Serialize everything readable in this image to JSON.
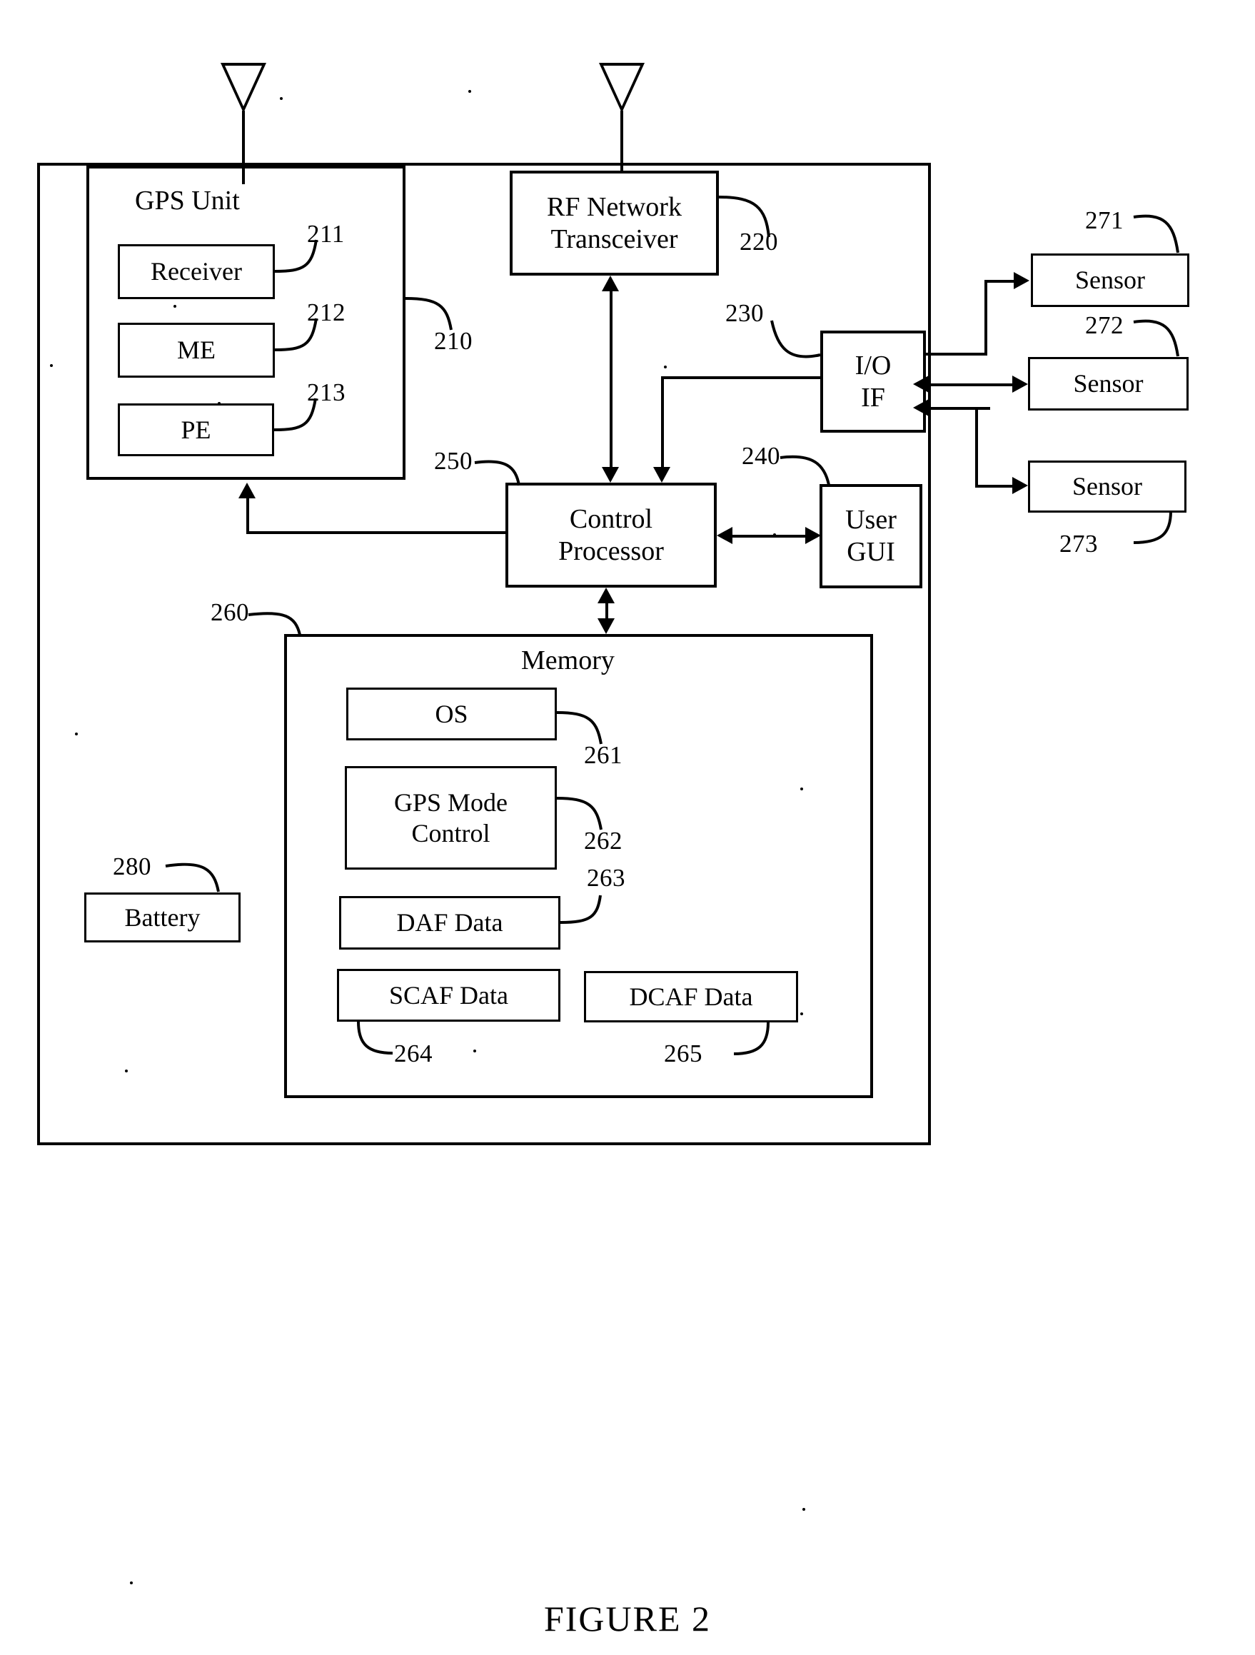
{
  "figure": {
    "caption": "FIGURE 2",
    "type": "patent-block-diagram"
  },
  "blocks": {
    "device_outer": {
      "label": "",
      "ref": ""
    },
    "gps_unit": {
      "label": "GPS Unit",
      "ref": "210"
    },
    "receiver": {
      "label": "Receiver",
      "ref": "211"
    },
    "me": {
      "label": "ME",
      "ref": "212"
    },
    "pe": {
      "label": "PE",
      "ref": "213"
    },
    "rf_transceiver": {
      "label": "RF Network\nTransceiver",
      "ref": "220"
    },
    "io_if": {
      "label": "I/O\nIF",
      "ref": "230"
    },
    "user_gui": {
      "label": "User\nGUI",
      "ref": "240"
    },
    "control_processor": {
      "label": "Control\nProcessor",
      "ref": "250"
    },
    "memory": {
      "label": "Memory",
      "ref": "260"
    },
    "os": {
      "label": "OS",
      "ref": "261"
    },
    "gps_mode_control": {
      "label": "GPS Mode\nControl",
      "ref": "262"
    },
    "daf_data": {
      "label": "DAF Data",
      "ref": "263"
    },
    "scaf_data": {
      "label": "SCAF Data",
      "ref": "264"
    },
    "dcaf_data": {
      "label": "DCAF Data",
      "ref": "265"
    },
    "sensor_1": {
      "label": "Sensor",
      "ref": "271"
    },
    "sensor_2": {
      "label": "Sensor",
      "ref": "272"
    },
    "sensor_3": {
      "label": "Sensor",
      "ref": "273"
    },
    "battery": {
      "label": "Battery",
      "ref": "280"
    }
  },
  "icons": {
    "antenna_gps": "antenna-icon",
    "antenna_rf": "antenna-icon"
  },
  "connections": [
    {
      "from": "antenna_gps",
      "to": "gps_unit",
      "arrow": "none"
    },
    {
      "from": "antenna_rf",
      "to": "rf_transceiver",
      "arrow": "none"
    },
    {
      "from": "rf_transceiver",
      "to": "control_processor",
      "arrow": "both"
    },
    {
      "from": "io_if",
      "to": "control_processor",
      "arrow": "down"
    },
    {
      "from": "control_processor",
      "to": "user_gui",
      "arrow": "both"
    },
    {
      "from": "control_processor",
      "to": "gps_unit",
      "arrow": "up"
    },
    {
      "from": "control_processor",
      "to": "memory",
      "arrow": "both"
    },
    {
      "from": "io_if",
      "to": "sensor_1",
      "arrow": "right"
    },
    {
      "from": "io_if",
      "to": "sensor_2",
      "arrow": "both"
    },
    {
      "from": "io_if",
      "to": "sensor_3",
      "arrow": "right"
    }
  ]
}
